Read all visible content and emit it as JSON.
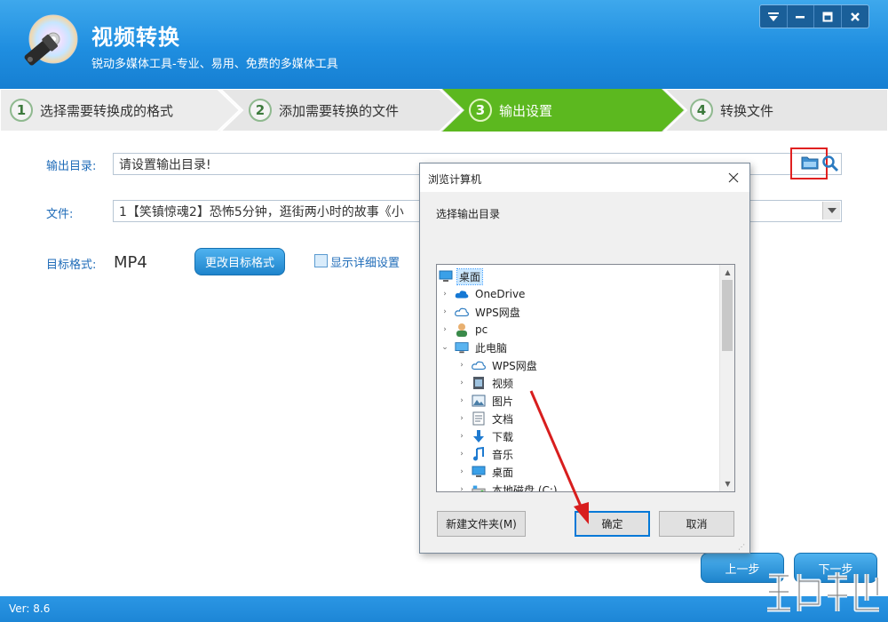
{
  "app": {
    "title": "视频转换",
    "subtitle": "锐动多媒体工具-专业、易用、免费的多媒体工具",
    "version": "Ver: 8.6"
  },
  "window_controls": [
    {
      "icon": "menu-dropdown-icon"
    },
    {
      "icon": "minimize-icon"
    },
    {
      "icon": "maximize-icon"
    },
    {
      "icon": "close-icon"
    }
  ],
  "steps": [
    {
      "num": "1",
      "label": "选择需要转换成的格式",
      "active": false
    },
    {
      "num": "2",
      "label": "添加需要转换的文件",
      "active": false
    },
    {
      "num": "3",
      "label": "输出设置",
      "active": true
    },
    {
      "num": "4",
      "label": "转换文件",
      "active": false
    }
  ],
  "output": {
    "dir_label": "输出目录:",
    "dir_value": "请设置输出目录!",
    "file_label": "文件:",
    "file_value": "1【笑镇惊魂2】恐怖5分钟，逛街两小时的故事《小",
    "format_label": "目标格式:",
    "format_value": "MP4",
    "change_format_label": "更改目标格式",
    "detail_label": "显示详细设置"
  },
  "nav": {
    "prev_label": "上一步",
    "next_label": "下一步"
  },
  "dialog": {
    "title": "浏览计算机",
    "prompt": "选择输出目录",
    "tree": [
      {
        "label": "桌面",
        "icon": "desktop-icon",
        "level": 0,
        "chevron": "",
        "selected": true
      },
      {
        "label": "OneDrive",
        "icon": "onedrive-cloud-icon",
        "level": 1,
        "chevron": "›"
      },
      {
        "label": "WPS网盘",
        "icon": "wps-cloud-icon",
        "level": 1,
        "chevron": "›"
      },
      {
        "label": "pc",
        "icon": "user-icon",
        "level": 1,
        "chevron": "›"
      },
      {
        "label": "此电脑",
        "icon": "computer-icon",
        "level": 1,
        "chevron": "⌄"
      },
      {
        "label": "WPS网盘",
        "icon": "wps-cloud-icon",
        "level": 2,
        "chevron": "›"
      },
      {
        "label": "视频",
        "icon": "video-folder-icon",
        "level": 2,
        "chevron": "›"
      },
      {
        "label": "图片",
        "icon": "pictures-folder-icon",
        "level": 2,
        "chevron": "›"
      },
      {
        "label": "文档",
        "icon": "documents-folder-icon",
        "level": 2,
        "chevron": "›"
      },
      {
        "label": "下载",
        "icon": "downloads-folder-icon",
        "level": 2,
        "chevron": "›"
      },
      {
        "label": "音乐",
        "icon": "music-folder-icon",
        "level": 2,
        "chevron": "›"
      },
      {
        "label": "桌面",
        "icon": "desktop-icon",
        "level": 2,
        "chevron": "›"
      },
      {
        "label": "本地磁盘 (C:)",
        "icon": "disk-drive-icon",
        "level": 2,
        "chevron": "›"
      }
    ],
    "new_folder_label": "新建文件夹(M)",
    "ok_label": "确定",
    "cancel_label": "取消"
  },
  "colors": {
    "header_blue": "#1f8ee0",
    "active_step_green": "#5eb820",
    "label_blue": "#1e6bb8",
    "highlight_red": "#e02020"
  }
}
